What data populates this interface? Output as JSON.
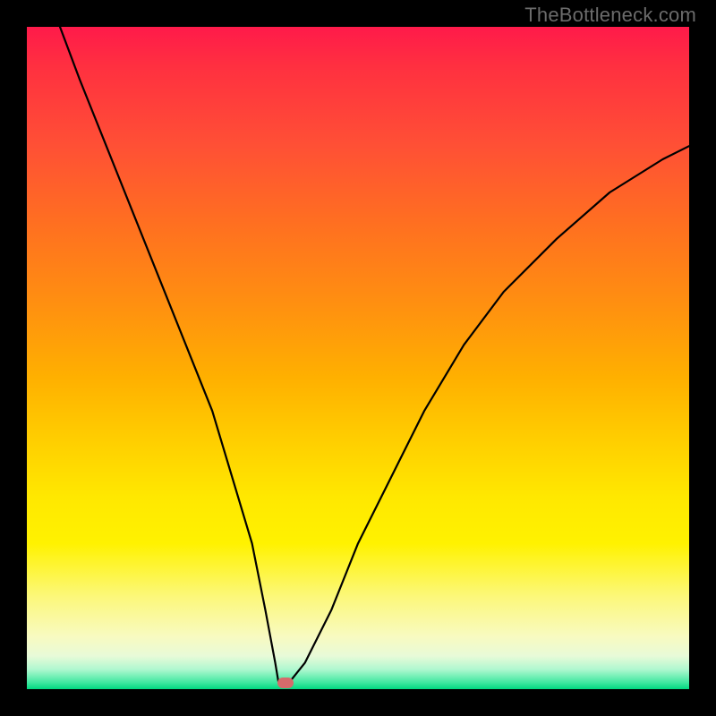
{
  "watermark": "TheBottleneck.com",
  "chart_data": {
    "type": "line",
    "title": "",
    "xlabel": "",
    "ylabel": "",
    "xlim": [
      0,
      100
    ],
    "ylim": [
      0,
      100
    ],
    "grid": false,
    "legend": false,
    "series": [
      {
        "name": "bottleneck-curve",
        "x": [
          5,
          8,
          12,
          16,
          20,
          24,
          28,
          31,
          34,
          36,
          37.5,
          38,
          39,
          40,
          42,
          46,
          50,
          55,
          60,
          66,
          72,
          80,
          88,
          96,
          100
        ],
        "values": [
          100,
          92,
          82,
          72,
          62,
          52,
          42,
          32,
          22,
          12,
          4,
          1,
          1,
          1.5,
          4,
          12,
          22,
          32,
          42,
          52,
          60,
          68,
          75,
          80,
          82
        ]
      }
    ],
    "marker": {
      "x": 39,
      "y": 1,
      "color": "#d66b6b"
    },
    "background_gradient": {
      "stops": [
        {
          "pos": 0,
          "color": "#ff1a4a"
        },
        {
          "pos": 30,
          "color": "#ff7020"
        },
        {
          "pos": 63,
          "color": "#ffd000"
        },
        {
          "pos": 92,
          "color": "#f8fac0"
        },
        {
          "pos": 100,
          "color": "#00d880"
        }
      ]
    }
  }
}
